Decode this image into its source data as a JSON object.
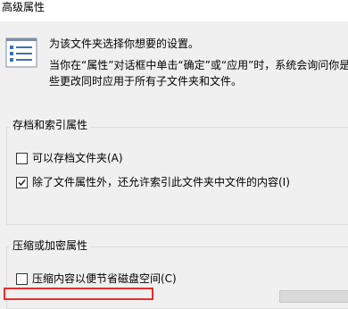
{
  "window": {
    "title": "高级属性"
  },
  "description": {
    "line1": "为该文件夹选择你想要的设置。",
    "line2": "当你在“属性”对话框中单击“确定”或“应用”时，系统会询问你是否",
    "line3": "些更改同时应用于所有子文件夹和文件。",
    "icon": "settings-list-icon"
  },
  "archive_group": {
    "label": "存档和索引属性",
    "options": [
      {
        "label": "可以存档文件夹(A)",
        "checked": false
      },
      {
        "label": "除了文件属性外，还允许索引此文件夹中文件的内容(I)",
        "checked": true
      }
    ]
  },
  "compress_group": {
    "label": "压缩或加密属性",
    "options": [
      {
        "label": "压缩内容以便节省磁盘空间(C)",
        "checked": false
      }
    ]
  },
  "colors": {
    "highlight_border": "#e03030",
    "dialog_background": "#f0f0f0"
  }
}
